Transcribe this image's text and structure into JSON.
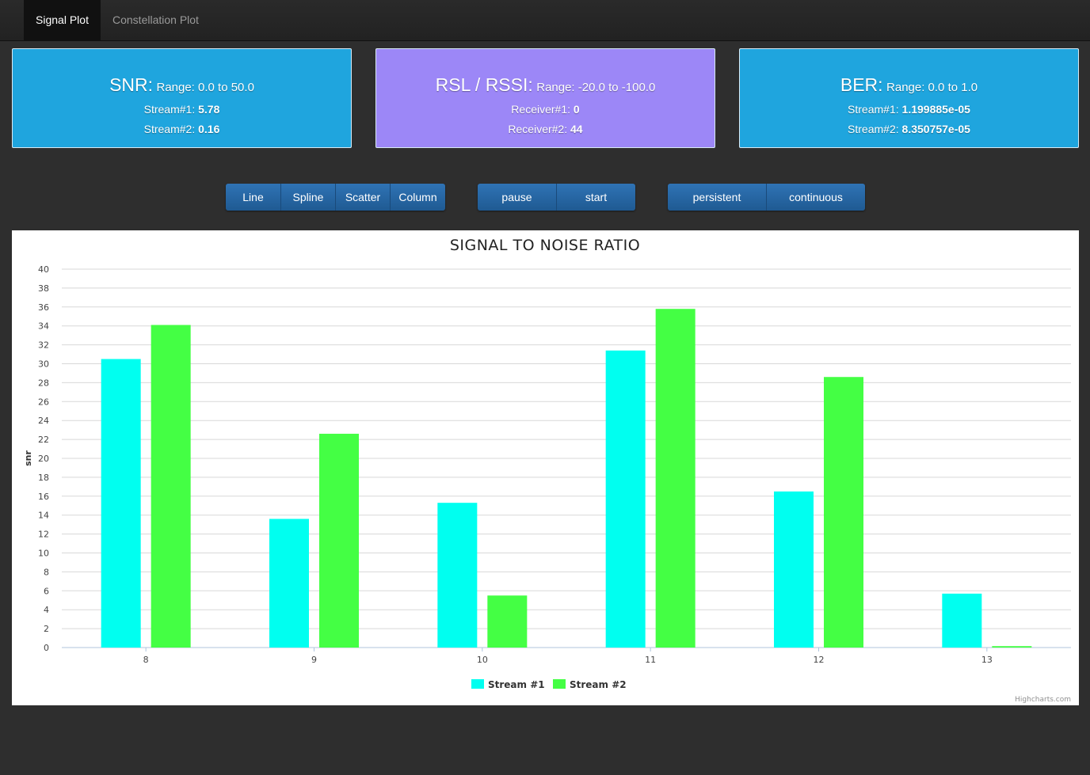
{
  "nav": {
    "tabs": [
      {
        "label": "Signal Plot",
        "active": true
      },
      {
        "label": "Constellation Plot",
        "active": false
      }
    ]
  },
  "cards": {
    "snr": {
      "title": "SNR:",
      "range": "Range: 0.0 to 50.0",
      "line1_label": "Stream#1:",
      "line1_value": "5.78",
      "line2_label": "Stream#2:",
      "line2_value": "0.16",
      "color": "#1fa5de"
    },
    "rsl": {
      "title": "RSL / RSSI:",
      "range": "Range: -20.0 to -100.0",
      "line1_label": "Receiver#1:",
      "line1_value": "0",
      "line2_label": "Receiver#2:",
      "line2_value": "44",
      "color": "#9c87f7"
    },
    "ber": {
      "title": "BER:",
      "range": "Range: 0.0 to 1.0",
      "line1_label": "Stream#1:",
      "line1_value": "1.199885e-05",
      "line2_label": "Stream#2:",
      "line2_value": "8.350757e-05",
      "color": "#1fa5de"
    }
  },
  "controls": {
    "chart_types": [
      "Line",
      "Spline",
      "Scatter",
      "Column"
    ],
    "playback": [
      "pause",
      "start"
    ],
    "mode": [
      "persistent",
      "continuous"
    ]
  },
  "chart_data": {
    "type": "bar",
    "title": "SIGNAL TO NOISE RATIO",
    "xlabel": "",
    "ylabel": "snr",
    "categories": [
      "8",
      "9",
      "10",
      "11",
      "12",
      "13"
    ],
    "ylim": [
      0,
      40
    ],
    "yticks": [
      0,
      2,
      4,
      6,
      8,
      10,
      12,
      14,
      16,
      18,
      20,
      22,
      24,
      26,
      28,
      30,
      32,
      34,
      36,
      38,
      40
    ],
    "grid": true,
    "legend": "bottom-center",
    "series": [
      {
        "name": "Stream #1",
        "color": "#00fff0",
        "values": [
          30.5,
          13.6,
          15.3,
          31.4,
          16.5,
          5.7
        ]
      },
      {
        "name": "Stream #2",
        "color": "#44ff44",
        "values": [
          34.1,
          22.6,
          5.5,
          35.8,
          28.6,
          0.15
        ]
      }
    ],
    "credit": "Highcharts.com"
  }
}
